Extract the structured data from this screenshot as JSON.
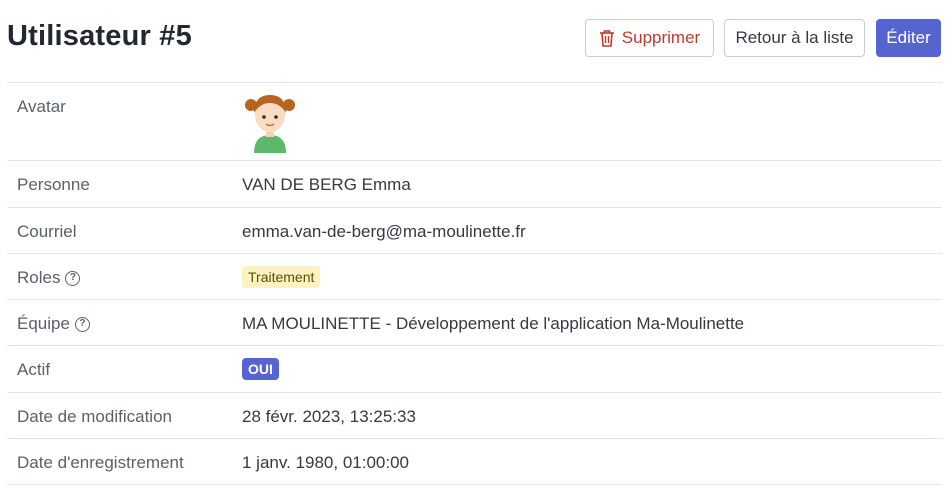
{
  "page": {
    "title": "Utilisateur #5",
    "actions": {
      "delete_label": "Supprimer",
      "back_label": "Retour à la liste",
      "edit_label": "Éditer"
    }
  },
  "details": {
    "avatar": {
      "label": "Avatar",
      "icon": "girl-avatar-icon"
    },
    "person": {
      "label": "Personne",
      "value": "VAN DE BERG Emma"
    },
    "email": {
      "label": "Courriel",
      "value": "emma.van-de-berg@ma-moulinette.fr"
    },
    "roles": {
      "label": "Roles",
      "value": "Traitement",
      "help_icon": "question-circle-icon"
    },
    "team": {
      "label": "Équipe",
      "value": "MA MOULINETTE - Développement de l'application Ma-Moulinette",
      "help_icon": "question-circle-icon"
    },
    "active": {
      "label": "Actif",
      "value": "OUI"
    },
    "modified": {
      "label": "Date de modification",
      "value": "28 févr. 2023, 13:25:33"
    },
    "registered": {
      "label": "Date d'enregistrement",
      "value": "1 janv. 1980, 01:00:00"
    }
  },
  "colors": {
    "primary": "#5664d2",
    "danger": "#c0392b",
    "role_badge_bg": "#fdf3c0",
    "link": "#4f5fb8"
  }
}
